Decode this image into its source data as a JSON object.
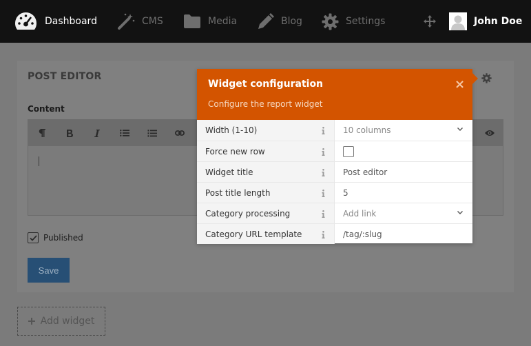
{
  "nav": {
    "items": [
      {
        "label": "Dashboard",
        "icon": "dashboard-gauge-icon"
      },
      {
        "label": "CMS",
        "icon": "magic-wand-icon"
      },
      {
        "label": "Media",
        "icon": "folder-icon"
      },
      {
        "label": "Blog",
        "icon": "pencil-icon"
      },
      {
        "label": "Settings",
        "icon": "gear-icon"
      }
    ],
    "move_icon": "move-arrows-icon",
    "user": {
      "name": "John Doe",
      "avatar_icon": "user-avatar-icon"
    }
  },
  "panel": {
    "title": "POST EDITOR",
    "content_label": "Content",
    "toolbar": [
      "paragraph-icon",
      "bold-icon",
      "italic-icon",
      "bullet-list-icon",
      "numbered-list-icon",
      "link-icon",
      "preview-eye-icon"
    ],
    "published_label": "Published",
    "published_checked": true,
    "save_label": "Save"
  },
  "add_widget": {
    "label": "Add widget"
  },
  "modal": {
    "title": "Widget configuration",
    "subtitle": "Configure the report widget",
    "close_glyph": "×",
    "rows": [
      {
        "label": "Width (1-10)",
        "value": "10 columns",
        "kind": "select"
      },
      {
        "label": "Force new row",
        "value": "",
        "kind": "checkbox",
        "checked": false
      },
      {
        "label": "Widget title",
        "value": "Post editor",
        "kind": "text"
      },
      {
        "label": "Post title length",
        "value": "5",
        "kind": "text"
      },
      {
        "label": "Category processing",
        "value": "Add link",
        "kind": "select"
      },
      {
        "label": "Category URL template",
        "value": "/tag/:slug",
        "kind": "text"
      }
    ]
  },
  "colors": {
    "accent": "#d35400",
    "topbar": "#121212",
    "overlay_bg": "#7b7b7b",
    "save_button": "#274f75"
  }
}
